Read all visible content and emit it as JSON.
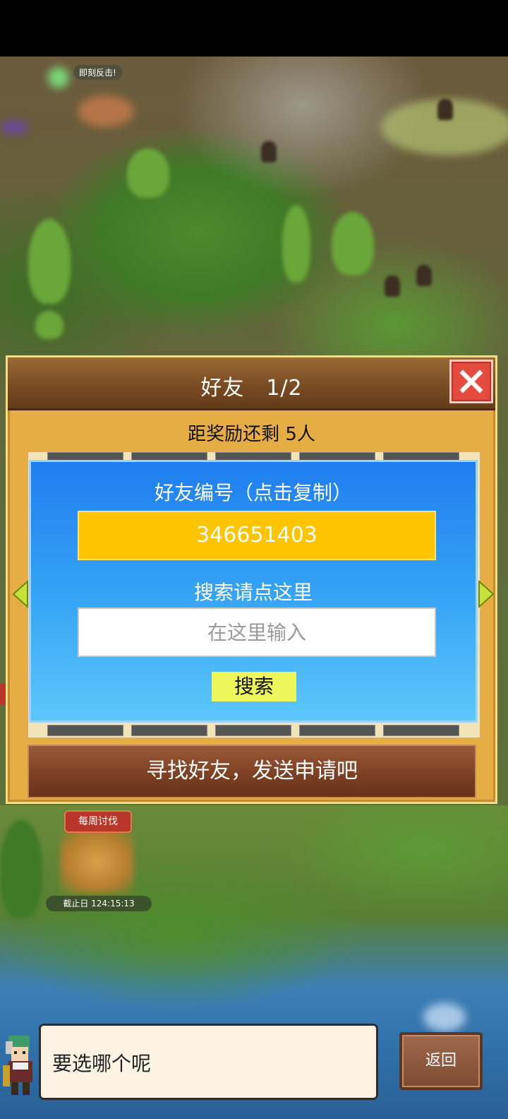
{
  "map": {
    "counterattack_label": "即刻反击!",
    "weekly_event_label": "每周讨伐",
    "deadline_label": "截止日 124:15:13"
  },
  "dialog": {
    "title": "好友　1/2",
    "reward_text": "距奖励还剩 5人",
    "friend_id_label": "好友编号（点击复制）",
    "friend_id_value": "346651403",
    "search_label": "搜索请点这里",
    "search_placeholder": "在这里输入",
    "search_button_label": "搜索",
    "find_friends_button_label": "寻找好友，发送申请吧"
  },
  "bottom": {
    "speech_text": "要选哪个呢",
    "back_button_label": "返回"
  },
  "colors": {
    "dialog_bg": "#e6ad45",
    "header_brown": "#7a4c24",
    "panel_blue": "#35a2f5",
    "friend_id_yellow": "#ffc400",
    "search_button_yellow": "#eef75a",
    "close_red": "#e34b3f"
  },
  "icons": {
    "close": "close-icon",
    "left_arrow": "chevron-left-icon",
    "right_arrow": "chevron-right-icon",
    "avatar": "character-avatar"
  }
}
